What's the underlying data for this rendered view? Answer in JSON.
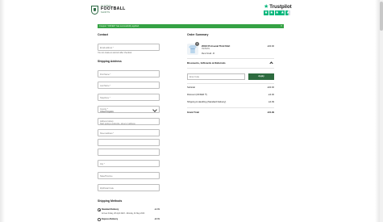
{
  "header": {
    "logo_top": "CLASSIC",
    "logo_main": "FOOTBALL",
    "logo_sub": "SHIRTS",
    "trustpilot_label": "Trustpilot"
  },
  "banner": {
    "text": "Coupon \"OFFER\" has successfully applied.",
    "close": "×",
    "color": "#35a244"
  },
  "contact": {
    "title": "Contact",
    "email_placeholder": "Email address *",
    "hint": "You can create an account after checkout."
  },
  "shipping_address": {
    "title": "Shipping Address",
    "fields": [
      {
        "label": "First Name *"
      },
      {
        "label": "Last Name *"
      },
      {
        "label": "Telephone *"
      },
      {
        "label": "Country *",
        "value": "United Kingdom"
      },
      {
        "label": "Address lookup",
        "value": "Start typing a postcode, street or address"
      },
      {
        "label": "Street address *"
      },
      {
        "label": ""
      },
      {
        "label": ""
      },
      {
        "label": "City *"
      },
      {
        "label": "State/Province"
      },
      {
        "label": "Zip/Postal Code"
      }
    ]
  },
  "shipping_methods": {
    "title": "Shipping Methods",
    "options": [
      {
        "label": "Standard Delivery",
        "price": "£4.99",
        "desc": "Arrives Friday, 28 April 2023 - Monday, 01 May 2023",
        "selected": true
      },
      {
        "label": "Express Delivery",
        "price": "£9.99",
        "selected": false
      }
    ]
  },
  "order_summary": {
    "title": "Order Summary",
    "product": {
      "name": "2004/ 05 Arsenal Third Shirt",
      "variant": "XS/XS/XL",
      "size": "Mens Small - M",
      "price": "£30.00",
      "qty": "1"
    },
    "discounts_title": "Discounts, Giftcards & Referrals",
    "code_placeholder": "Enter Code",
    "apply_label": "Apply",
    "subtotal_label": "Subtotal",
    "subtotal_value": "£30.00",
    "discount_label": "Discount (OFFER ®)",
    "discount_value": "-£3.00",
    "shipping_label": "Shipping & Handling (Standard Delivery)",
    "shipping_value": "£4.99",
    "total_label": "Grand Total",
    "total_value": "£31.99"
  },
  "colors": {
    "accent": "#2d6b3f",
    "trustpilot": "#00b67a"
  }
}
